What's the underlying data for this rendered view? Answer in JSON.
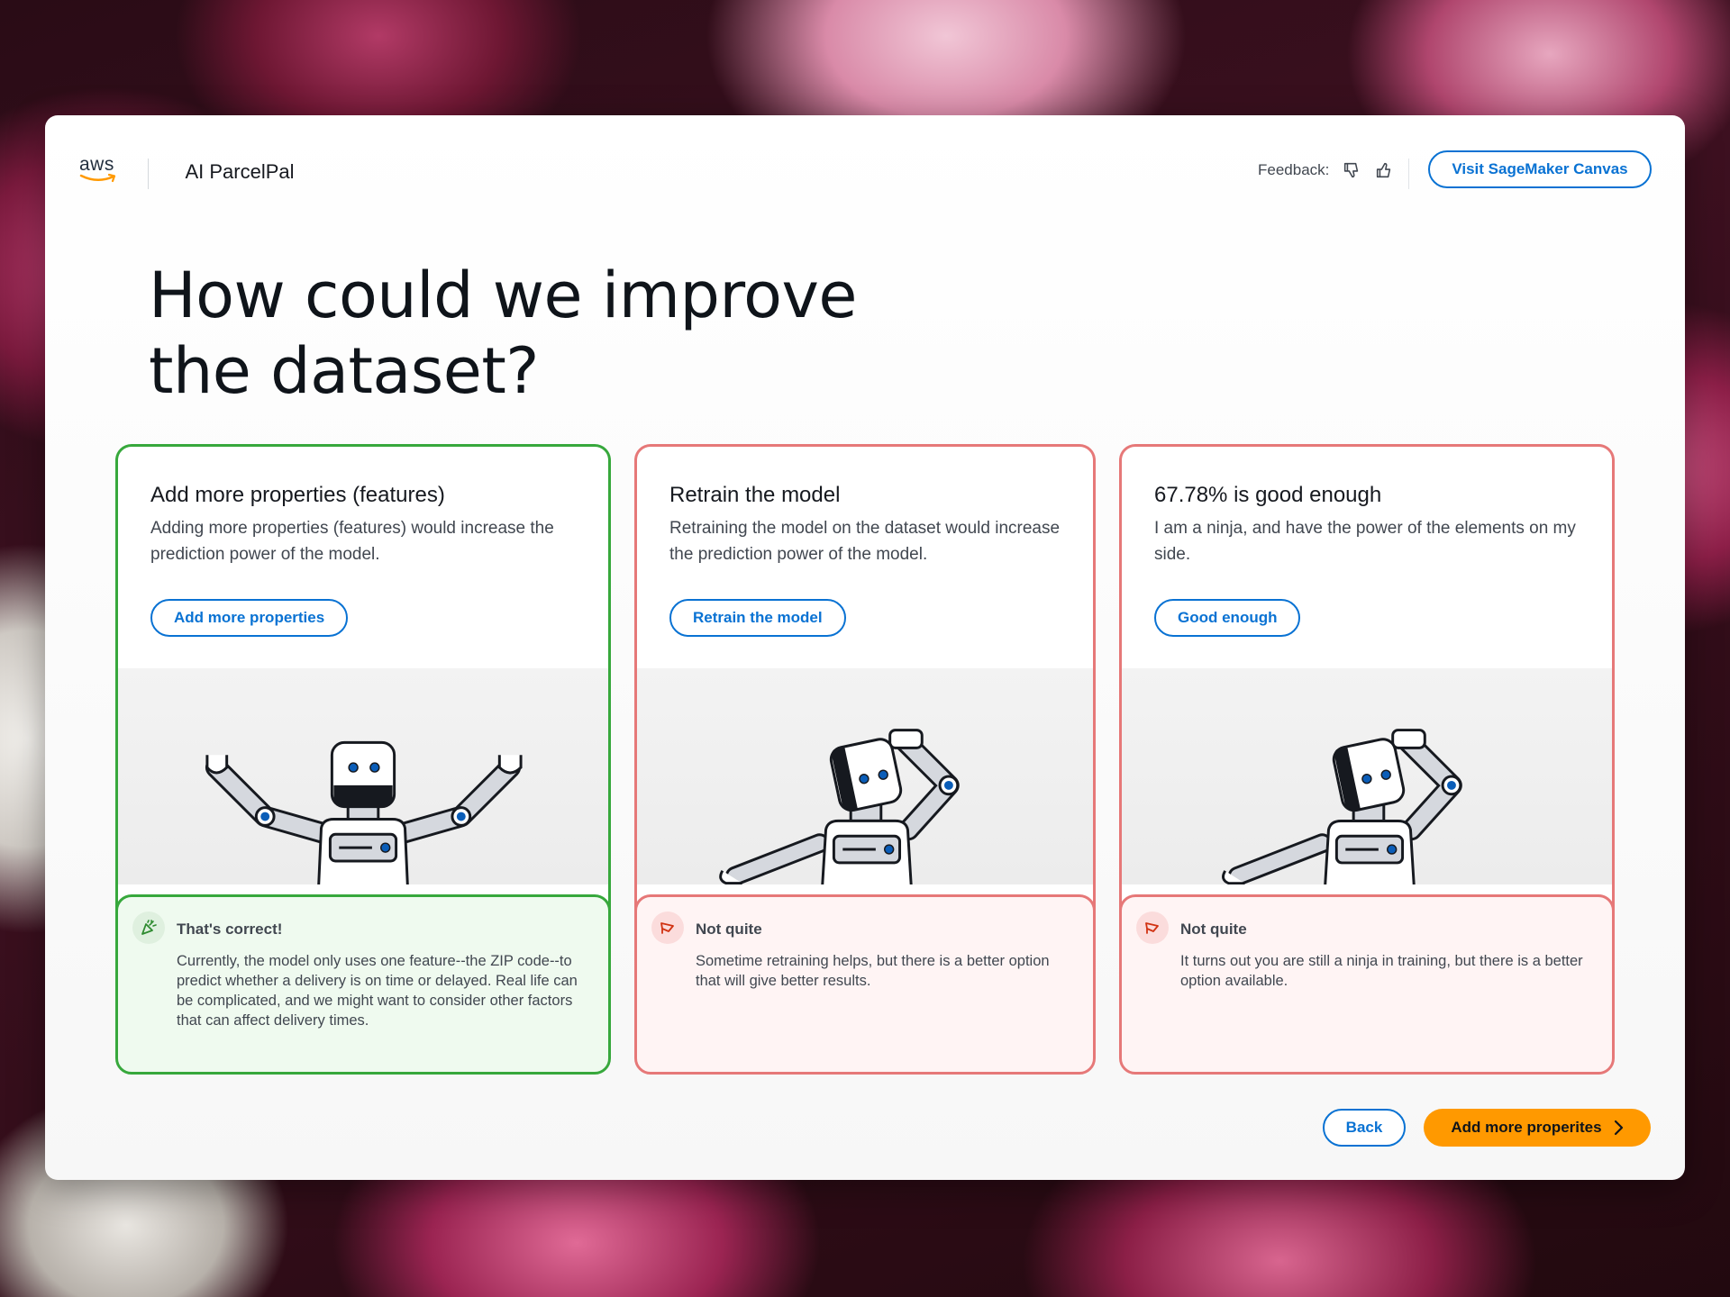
{
  "header": {
    "logo_text": "aws",
    "app_title": "AI ParcelPal",
    "feedback_label": "Feedback:",
    "visit_button": "Visit SageMaker Canvas"
  },
  "page": {
    "title_line1": "How could we improve",
    "title_line2": "the dataset?"
  },
  "cards": [
    {
      "title": "Add more properties (features)",
      "description": "Adding more properties (features) would increase the prediction power of the model.",
      "button": "Add more properties",
      "state": "correct",
      "robot_pose": "arms-up",
      "feedback_heading": "That's correct!",
      "feedback_text": "Currently, the model only uses one feature--the ZIP code--to predict whether a delivery is on time or delayed. Real life can be complicated, and we might want to consider other factors that can affect delivery times."
    },
    {
      "title": "Retrain the model",
      "description": "Retraining the model on the dataset would increase the prediction power of the model.",
      "button": "Retrain the model",
      "state": "incorrect",
      "robot_pose": "head-scratch",
      "feedback_heading": "Not quite",
      "feedback_text": "Sometime retraining helps, but there is a better option that will give better results."
    },
    {
      "title": "67.78% is good enough",
      "description": "I am a ninja, and have the power of the elements on my side.",
      "button": "Good enough",
      "state": "incorrect",
      "robot_pose": "head-scratch",
      "feedback_heading": "Not quite",
      "feedback_text": "It turns out you are still a ninja in training, but there is a better option available."
    }
  ],
  "footer": {
    "back_button": "Back",
    "next_button": "Add more properites"
  },
  "colors": {
    "accent_blue": "#0972d3",
    "primary_orange": "#ff9900",
    "correct_green": "#37a83c",
    "incorrect_red": "#e67878"
  },
  "icons": {
    "thumbs_down": "thumbs-down-icon",
    "thumbs_up": "thumbs-up-icon",
    "correct": "party-popper-icon",
    "incorrect": "megaphone-icon",
    "next": "chevron-right-icon"
  }
}
